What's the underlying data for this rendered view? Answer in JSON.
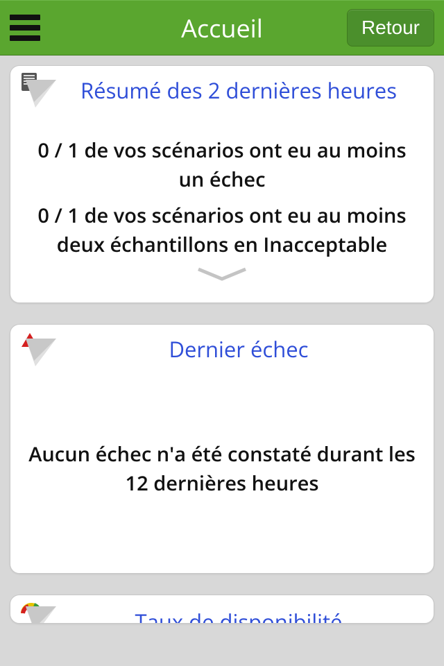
{
  "header": {
    "title": "Accueil",
    "back_label": "Retour"
  },
  "cards": [
    {
      "title": "Résumé des 2 dernières heures",
      "lines": [
        "0 / 1 de vos scénarios ont eu au moins un échec",
        "0 / 1 de vos scénarios ont eu au moins deux échantillons en Inacceptable"
      ],
      "icon": "document-fold-icon"
    },
    {
      "title": "Dernier échec",
      "lines": [
        "Aucun échec n'a été constaté durant les 12 dernières heures"
      ],
      "icon": "alert-fold-icon"
    },
    {
      "title": "Taux de disponibilité",
      "lines": [],
      "icon": "gauge-fold-icon"
    }
  ]
}
